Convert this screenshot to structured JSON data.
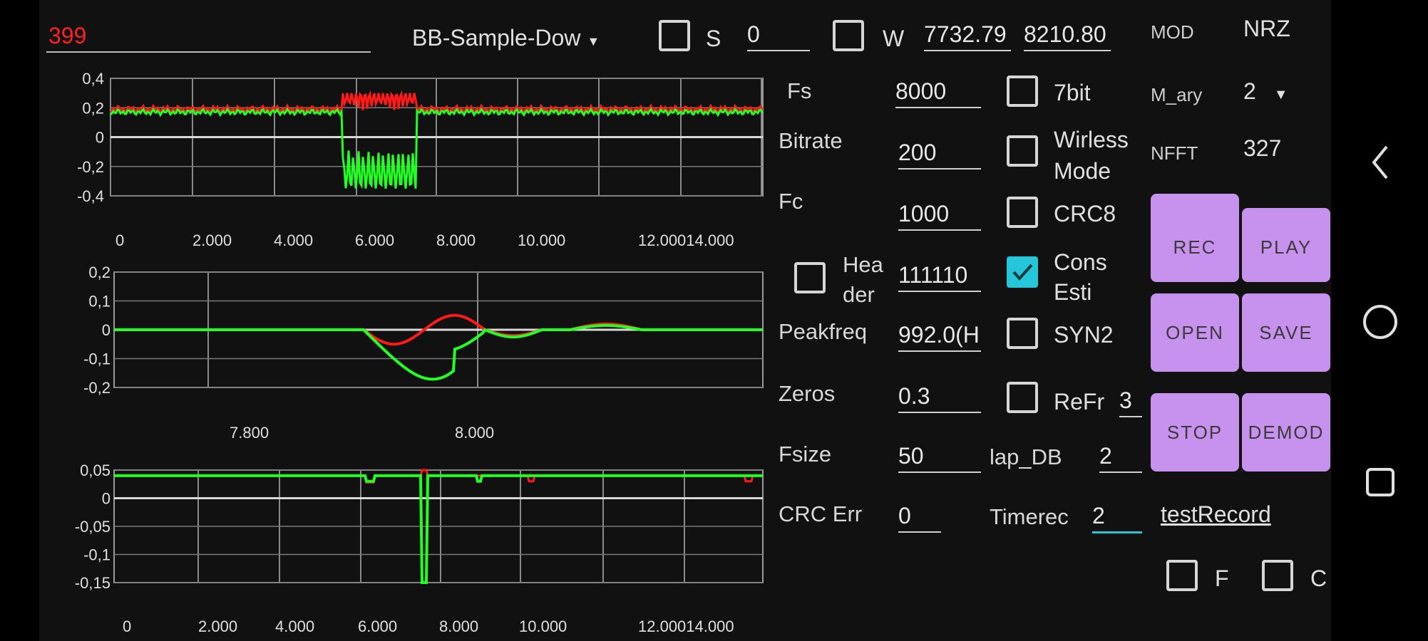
{
  "top": {
    "count": "399",
    "mode_select": "BB-Sample-Dow",
    "s_label": "S",
    "s_value": "0",
    "w_label": "W",
    "w_value1": "7732.79",
    "w_value2": "8210.80"
  },
  "chart_data": [
    {
      "type": "line",
      "ylim": [
        -0.4,
        0.4
      ],
      "yticks": [
        "0,4",
        "0,2",
        "0",
        "-0,2",
        "-0,4"
      ],
      "xticks": [
        "0",
        "2.000",
        "4.000",
        "6.000",
        "8.000",
        "10.000",
        "12.00014.000"
      ],
      "series": [
        {
          "color": "#ff1a1a"
        },
        {
          "color": "#22ff22"
        }
      ]
    },
    {
      "type": "line",
      "ylim": [
        -0.2,
        0.2
      ],
      "yticks": [
        "0,2",
        "0,1",
        "0",
        "-0,1",
        "-0,2"
      ],
      "xticks": [
        "7.800",
        "8.000"
      ],
      "series": [
        {
          "color": "#ff1a1a"
        },
        {
          "color": "#22ff22"
        }
      ]
    },
    {
      "type": "line",
      "ylim": [
        -0.15,
        0.05
      ],
      "yticks": [
        "0,05",
        "0",
        "-0,05",
        "-0,1",
        "-0,15"
      ],
      "xticks": [
        "0",
        "2.000",
        "4.000",
        "6.000",
        "8.000",
        "10.000",
        "12.00014.000"
      ],
      "series": [
        {
          "color": "#ff1a1a"
        },
        {
          "color": "#22ff22"
        }
      ]
    }
  ],
  "params": {
    "fs_label": "Fs",
    "fs_value": "8000",
    "bitrate_label": "Bitrate",
    "bitrate_value": "200",
    "fc_label": "Fc",
    "fc_value": "1000",
    "header_label_1": "Hea",
    "header_label_2": "der",
    "header_value": "111110",
    "peakfreq_label": "Peakfreq",
    "peakfreq_value": "992.0(H",
    "zeros_label": "Zeros",
    "zeros_value": "0.3",
    "fsize_label": "Fsize",
    "fsize_value": "50",
    "lapdb_label": "lap_DB",
    "lapdb_value": "2",
    "crcerr_label": "CRC Err",
    "crcerr_value": "0",
    "timerec_label": "Timerec",
    "timerec_value": "2",
    "record_name": "testRecord"
  },
  "options": {
    "bit7": "7bit",
    "wireless_1": "Wirless",
    "wireless_2": "Mode",
    "crc8": "CRC8",
    "cons_1": "Cons",
    "cons_2": "Esti",
    "syn2": "SYN2",
    "refr_label": "ReFr",
    "refr_value": "3",
    "f_label": "F",
    "c_label": "C"
  },
  "settings": {
    "mod_label": "MOD",
    "mod_value": "NRZ",
    "mary_label": "M_ary",
    "mary_value": "2",
    "nfft_label": "NFFT",
    "nfft_value": "327"
  },
  "buttons": {
    "rec": "REC",
    "play": "PLAY",
    "open": "OPEN",
    "save": "SAVE",
    "stop": "STOP",
    "demod": "DEMOD"
  },
  "colors": {
    "accent_button": "#c792ee",
    "checked": "#26c6da",
    "count_text": "#ff2020"
  }
}
